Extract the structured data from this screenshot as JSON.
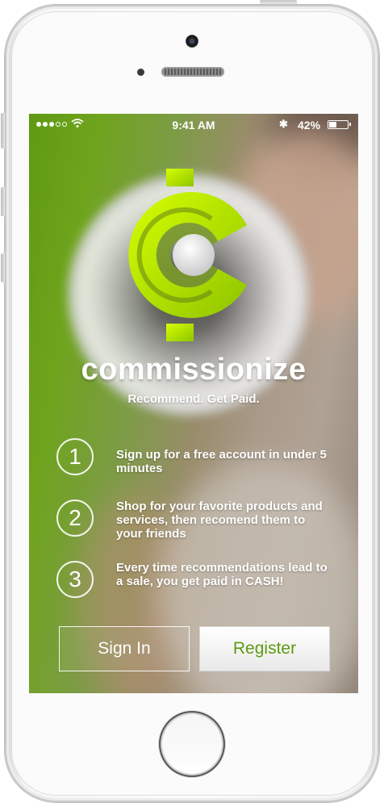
{
  "status_bar": {
    "time": "9:41 AM",
    "battery_text": "42%",
    "battery_level": 0.42,
    "signal_bars": 3,
    "bluetooth_icon": "bluetooth-icon",
    "wifi_icon": "wifi-icon"
  },
  "brand": {
    "name": "commissionize",
    "tagline": "Recommend. Get Paid.",
    "logo_icon": "commissionize-cent-logo",
    "accent_color": "#c4f000"
  },
  "steps": [
    {
      "number": "1",
      "text": "Sign up for a free account in under 5 minutes"
    },
    {
      "number": "2",
      "text": "Shop for your favorite products and services, then recomend them to your friends"
    },
    {
      "number": "3",
      "text": "Every time recommendations lead to a sale, you get paid in CASH!"
    }
  ],
  "actions": {
    "sign_in_label": "Sign In",
    "register_label": "Register"
  }
}
